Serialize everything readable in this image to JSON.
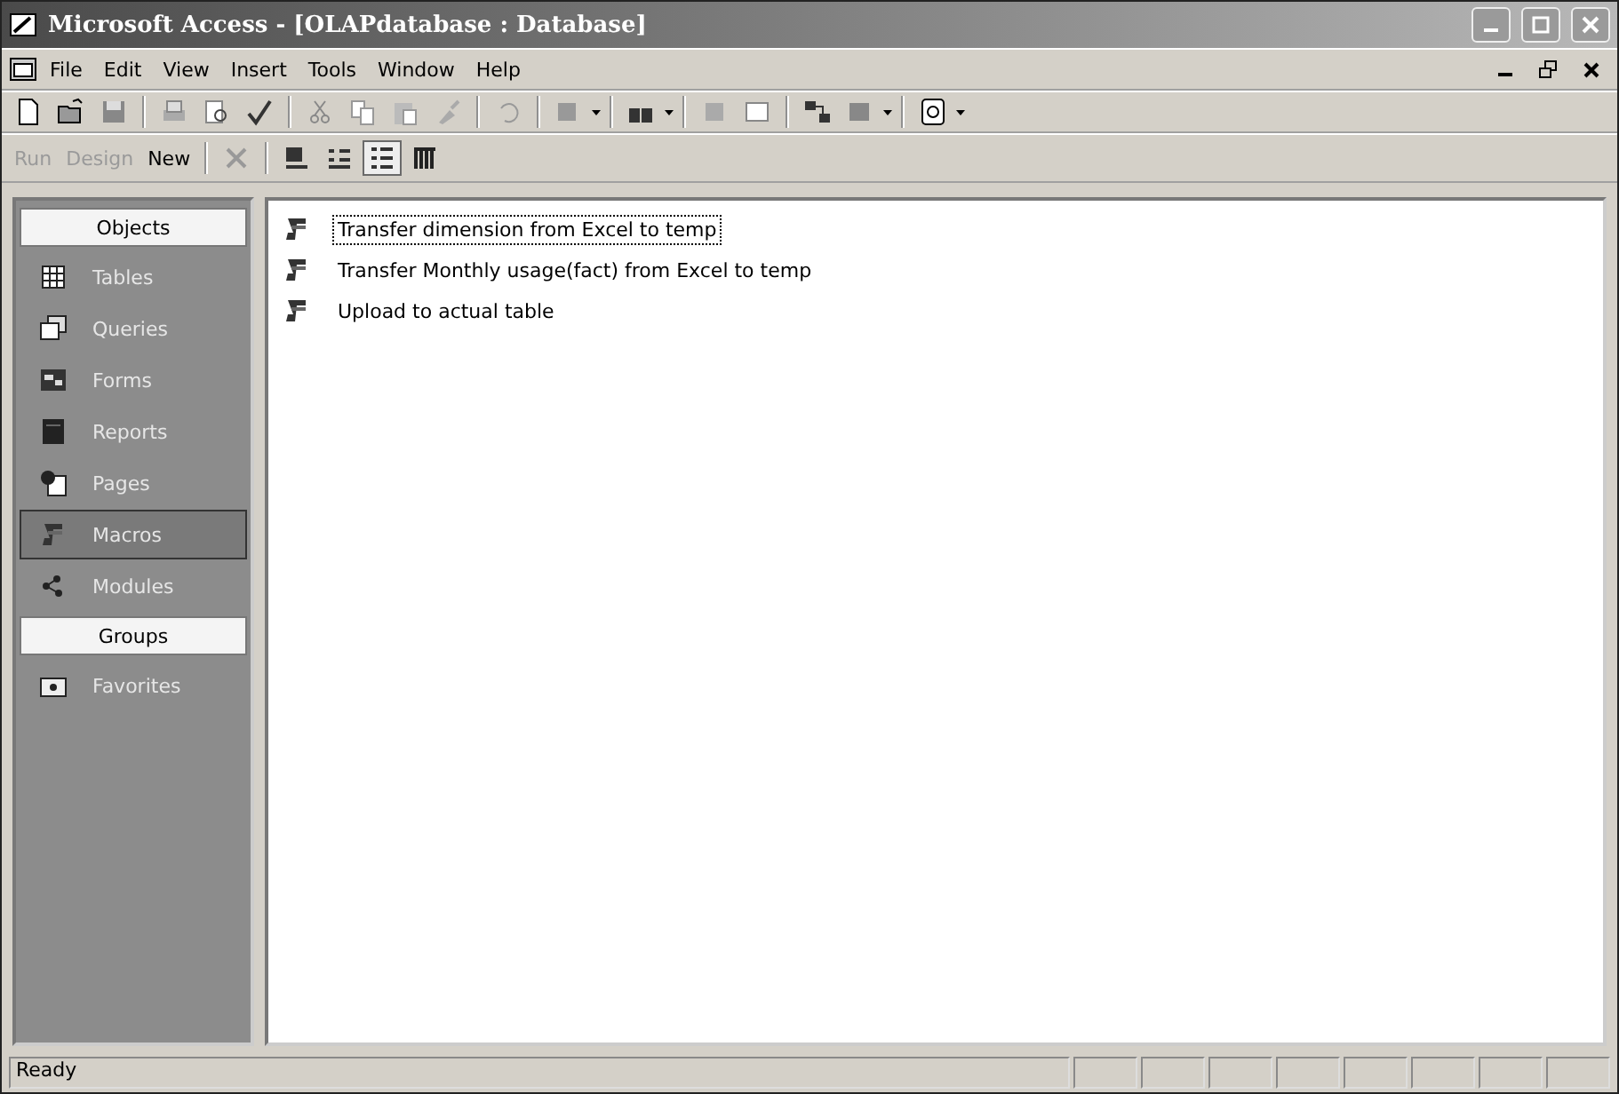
{
  "window": {
    "title": "Microsoft Access - [OLAPdatabase : Database]"
  },
  "menu": [
    "File",
    "Edit",
    "View",
    "Insert",
    "Tools",
    "Window",
    "Help"
  ],
  "db_toolbar": {
    "buttons": [
      {
        "label": "Run",
        "disabled": true
      },
      {
        "label": "Design",
        "disabled": true
      },
      {
        "label": "New",
        "disabled": false
      }
    ],
    "views": [
      {
        "kind": "large",
        "selected": false
      },
      {
        "kind": "small",
        "selected": false
      },
      {
        "kind": "list",
        "selected": true
      },
      {
        "kind": "details",
        "selected": false
      }
    ]
  },
  "sidebar": {
    "sections": [
      {
        "title": "Objects",
        "items": [
          {
            "label": "Tables",
            "kind": "tables",
            "selected": false
          },
          {
            "label": "Queries",
            "kind": "queries",
            "selected": false
          },
          {
            "label": "Forms",
            "kind": "forms",
            "selected": false
          },
          {
            "label": "Reports",
            "kind": "reports",
            "selected": false
          },
          {
            "label": "Pages",
            "kind": "pages",
            "selected": false
          },
          {
            "label": "Macros",
            "kind": "macros",
            "selected": true
          },
          {
            "label": "Modules",
            "kind": "modules",
            "selected": false
          }
        ]
      },
      {
        "title": "Groups",
        "items": [
          {
            "label": "Favorites",
            "kind": "favorites",
            "selected": false
          }
        ]
      }
    ]
  },
  "objects": [
    {
      "name": "Transfer dimension from Excel to temp",
      "selected": true
    },
    {
      "name": "Transfer Monthly usage(fact) from Excel to temp",
      "selected": false
    },
    {
      "name": "Upload to actual table",
      "selected": false
    }
  ],
  "status_bar": {
    "text": "Ready"
  }
}
